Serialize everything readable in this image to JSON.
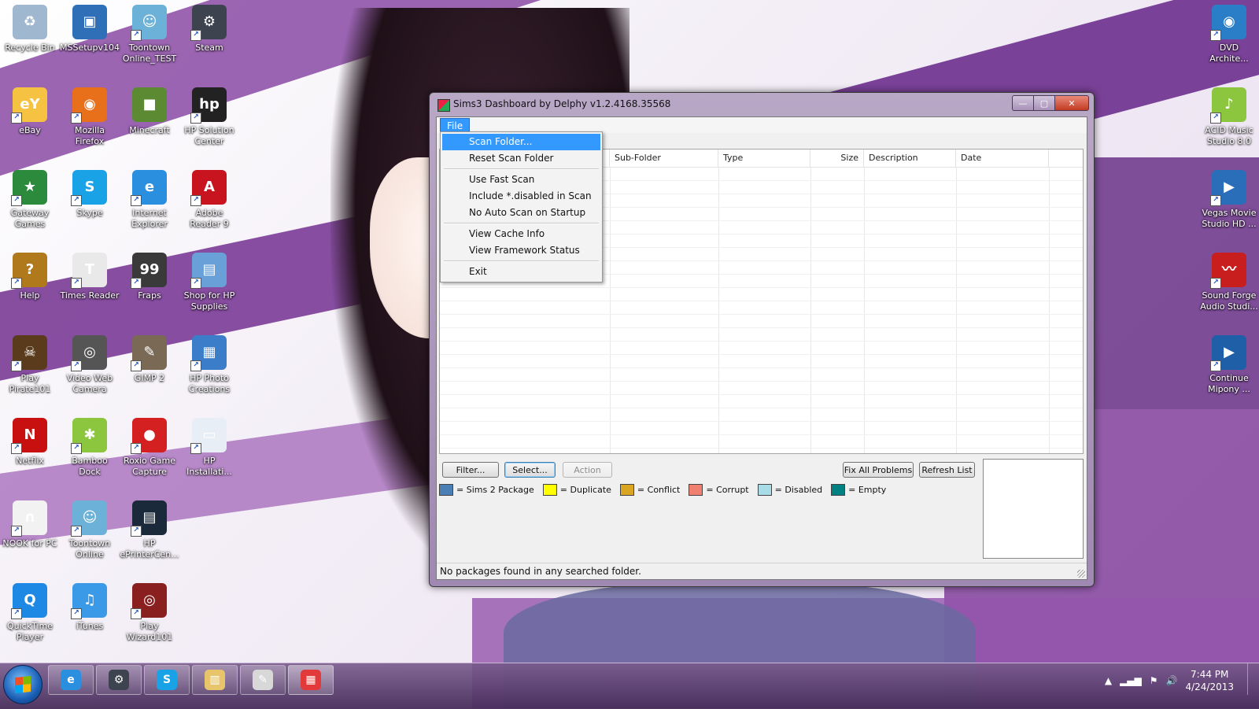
{
  "desktop": {
    "icons_left": [
      {
        "label": "Recycle Bin",
        "icon": "recycle-bin-icon",
        "color": "#9fb7cf",
        "glyph": "♻",
        "shortcut": false
      },
      {
        "label": "MSSetupv104",
        "icon": "setup-icon",
        "color": "#2e6fb8",
        "glyph": "▣",
        "shortcut": false
      },
      {
        "label": "Toontown Online_TEST",
        "icon": "toontown-icon",
        "color": "#6cb2d8",
        "glyph": "☺",
        "shortcut": true
      },
      {
        "label": "Steam",
        "icon": "steam-icon",
        "color": "#3d4450",
        "glyph": "⚙",
        "shortcut": true
      },
      {
        "label": "eBay",
        "icon": "ebay-icon",
        "color": "#f5c242",
        "glyph": "eY",
        "shortcut": true
      },
      {
        "label": "Mozilla Firefox",
        "icon": "firefox-icon",
        "color": "#e8701a",
        "glyph": "◉",
        "shortcut": true
      },
      {
        "label": "Minecraft",
        "icon": "minecraft-icon",
        "color": "#5b8a32",
        "glyph": "■",
        "shortcut": false
      },
      {
        "label": "HP Solution Center",
        "icon": "hp-icon",
        "color": "#222222",
        "glyph": "hp",
        "shortcut": true
      },
      {
        "label": "Gateway Games",
        "icon": "gateway-games-icon",
        "color": "#2c8a3c",
        "glyph": "★",
        "shortcut": true
      },
      {
        "label": "Skype",
        "icon": "skype-icon",
        "color": "#19a2e6",
        "glyph": "S",
        "shortcut": true
      },
      {
        "label": "Internet Explorer",
        "icon": "internet-explorer-icon",
        "color": "#2b8fe0",
        "glyph": "e",
        "shortcut": true
      },
      {
        "label": "Adobe Reader 9",
        "icon": "adobe-reader-icon",
        "color": "#c8141e",
        "glyph": "A",
        "shortcut": true
      },
      {
        "label": "Help",
        "icon": "help-icon",
        "color": "#b07a1c",
        "glyph": "?",
        "shortcut": true
      },
      {
        "label": "Times Reader",
        "icon": "times-reader-icon",
        "color": "#e9e9e9",
        "glyph": "T",
        "shortcut": true
      },
      {
        "label": "Fraps",
        "icon": "fraps-icon",
        "color": "#3a3a3a",
        "glyph": "99",
        "shortcut": true
      },
      {
        "label": "Shop for HP Supplies",
        "icon": "hp-supplies-icon",
        "color": "#6aa0d8",
        "glyph": "▤",
        "shortcut": true
      },
      {
        "label": "Play Pirate101",
        "icon": "pirate101-icon",
        "color": "#5a3b1c",
        "glyph": "☠",
        "shortcut": true
      },
      {
        "label": "Video Web Camera",
        "icon": "webcam-icon",
        "color": "#555555",
        "glyph": "◎",
        "shortcut": true
      },
      {
        "label": "GIMP 2",
        "icon": "gimp-icon",
        "color": "#7a6a55",
        "glyph": "✎",
        "shortcut": true
      },
      {
        "label": "HP Photo Creations",
        "icon": "hp-photo-icon",
        "color": "#3b7dc9",
        "glyph": "▦",
        "shortcut": true
      },
      {
        "label": "Netflix",
        "icon": "netflix-icon",
        "color": "#c81010",
        "glyph": "N",
        "shortcut": true
      },
      {
        "label": "Bamboo Dock",
        "icon": "bamboo-dock-icon",
        "color": "#8cc63f",
        "glyph": "✱",
        "shortcut": true
      },
      {
        "label": "Roxio Game Capture",
        "icon": "roxio-icon",
        "color": "#d42020",
        "glyph": "●",
        "shortcut": true
      },
      {
        "label": "HP Installati...",
        "icon": "hp-install-icon",
        "color": "#e8eef6",
        "glyph": "▭",
        "shortcut": true
      },
      {
        "label": "NOOK for PC",
        "icon": "nook-icon",
        "color": "#f2f2f2",
        "glyph": "∩",
        "shortcut": true
      },
      {
        "label": "Toontown Online",
        "icon": "toontown-icon",
        "color": "#6cb2d8",
        "glyph": "☺",
        "shortcut": true
      },
      {
        "label": "HP ePrinterCen...",
        "icon": "hp-eprinter-icon",
        "color": "#1b2a3a",
        "glyph": "▤",
        "shortcut": true
      },
      {
        "label": "",
        "icon": "",
        "color": "",
        "glyph": "",
        "shortcut": false
      },
      {
        "label": "QuickTime Player",
        "icon": "quicktime-icon",
        "color": "#1e88e5",
        "glyph": "Q",
        "shortcut": true
      },
      {
        "label": "iTunes",
        "icon": "itunes-icon",
        "color": "#3b9ae8",
        "glyph": "♫",
        "shortcut": true
      },
      {
        "label": "Play Wizard101",
        "icon": "wizard101-icon",
        "color": "#8a1f1f",
        "glyph": "◎",
        "shortcut": true
      }
    ],
    "icons_right": [
      {
        "label": "DVD Archite...",
        "icon": "dvd-architect-icon",
        "color": "#2a7ec8",
        "glyph": "◉",
        "shortcut": true
      },
      {
        "label": "ACID Music Studio 8.0",
        "icon": "acid-music-icon",
        "color": "#8cc63f",
        "glyph": "♪",
        "shortcut": true
      },
      {
        "label": "Vegas Movie Studio HD ...",
        "icon": "vegas-movie-icon",
        "color": "#2a6db8",
        "glyph": "▶",
        "shortcut": true
      },
      {
        "label": "Sound Forge Audio Studi...",
        "icon": "sound-forge-icon",
        "color": "#c81e1e",
        "glyph": "〰",
        "shortcut": true
      },
      {
        "label": "Continue Mipony ...",
        "icon": "mipony-icon",
        "color": "#1e5fa8",
        "glyph": "▶",
        "shortcut": true
      }
    ]
  },
  "window": {
    "title": "Sims3 Dashboard by Delphy v1.2.4168.35568",
    "min_glyph": "—",
    "max_glyph": "▢",
    "close_glyph": "✕",
    "menu": {
      "file_label": "File"
    },
    "dropdown": {
      "groups": [
        [
          {
            "label": "Scan Folder...",
            "selected": true
          },
          {
            "label": "Reset Scan Folder",
            "selected": false
          }
        ],
        [
          {
            "label": "Use Fast Scan",
            "selected": false
          },
          {
            "label": "Include *.disabled in Scan",
            "selected": false
          },
          {
            "label": "No Auto Scan on Startup",
            "selected": false
          }
        ],
        [
          {
            "label": "View Cache Info",
            "selected": false
          },
          {
            "label": "View Framework Status",
            "selected": false
          }
        ],
        [
          {
            "label": "Exit",
            "selected": false
          }
        ]
      ]
    },
    "grid": {
      "columns": [
        {
          "label": "",
          "align": "left"
        },
        {
          "label": "Sub-Folder",
          "align": "left"
        },
        {
          "label": "Type",
          "align": "left"
        },
        {
          "label": "Size",
          "align": "right"
        },
        {
          "label": "Description",
          "align": "left"
        },
        {
          "label": "Date",
          "align": "left"
        }
      ],
      "rows": []
    },
    "buttons": {
      "filter": "Filter...",
      "select": "Select...",
      "action": "Action",
      "fix_all": "Fix All Problems",
      "refresh": "Refresh List"
    },
    "legend": [
      {
        "label": "= Sims 2 Package",
        "color": "#4a7fb5"
      },
      {
        "label": "= Duplicate",
        "color": "#ffff00"
      },
      {
        "label": "= Conflict",
        "color": "#daa520"
      },
      {
        "label": "= Corrupt",
        "color": "#f08070"
      },
      {
        "label": "= Disabled",
        "color": "#a8dce6"
      },
      {
        "label": "= Empty",
        "color": "#008080"
      }
    ],
    "status": "No packages found in any searched folder."
  },
  "taskbar": {
    "pinned": [
      {
        "icon": "internet-explorer-icon",
        "color": "#2b8fe0",
        "glyph": "e"
      },
      {
        "icon": "steam-icon",
        "color": "#3d4450",
        "glyph": "⚙"
      },
      {
        "icon": "skype-icon",
        "color": "#19a2e6",
        "glyph": "S"
      },
      {
        "icon": "windows-explorer-icon",
        "color": "#e8c46a",
        "glyph": "▥"
      },
      {
        "icon": "paint-icon",
        "color": "#d8d8d8",
        "glyph": "✎"
      },
      {
        "icon": "sims3-dashboard-icon",
        "color": "#e23a3a",
        "glyph": "▦"
      }
    ],
    "time": "7:44 PM",
    "date": "4/24/2013"
  }
}
